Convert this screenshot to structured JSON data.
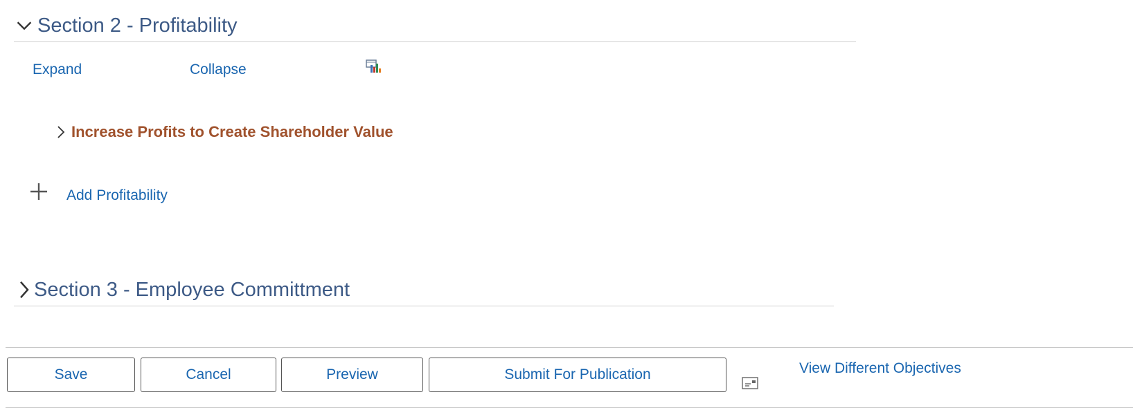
{
  "section2": {
    "title": "Section 2 - Profitability",
    "expanded": true,
    "links": {
      "expand": "Expand",
      "collapse": "Collapse"
    },
    "chart_icon": "chart-icon",
    "objective": {
      "title": "Increase Profits to Create Shareholder Value",
      "expanded": false
    },
    "add_label": "Add Profitability"
  },
  "section3": {
    "title": "Section 3 - Employee Committment",
    "expanded": false
  },
  "footer": {
    "buttons": {
      "save": "Save",
      "cancel": "Cancel",
      "preview": "Preview",
      "submit": "Submit For Publication"
    },
    "notify_icon": "notify-icon",
    "view_link": "View Different Objectives"
  },
  "colors": {
    "section_title": "#3d5a86",
    "link": "#1a66b0",
    "objective_title": "#a0522d"
  }
}
